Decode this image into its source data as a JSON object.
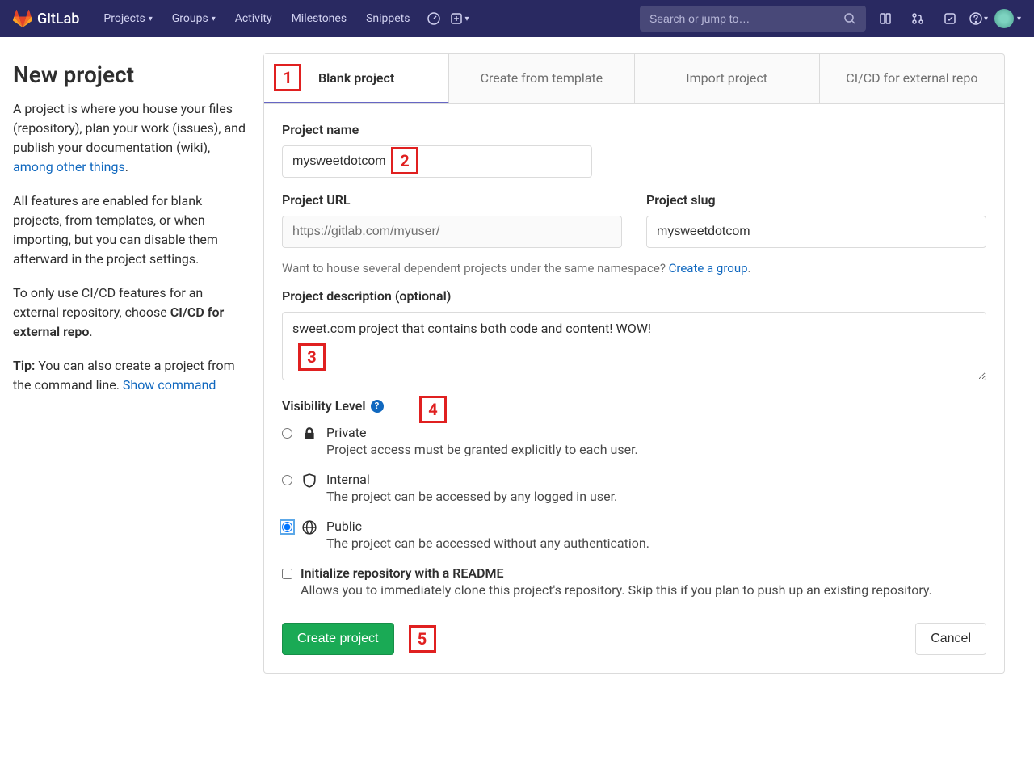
{
  "header": {
    "brand": "GitLab",
    "nav": {
      "projects": "Projects",
      "groups": "Groups",
      "activity": "Activity",
      "milestones": "Milestones",
      "snippets": "Snippets"
    },
    "search_placeholder": "Search or jump to…"
  },
  "sidebar": {
    "title": "New project",
    "p1_a": "A project is where you house your files (repository), plan your work (issues), and publish your documentation (wiki), ",
    "p1_link": "among other things",
    "p1_b": ".",
    "p2": "All features are enabled for blank projects, from templates, or when importing, but you can disable them afterward in the project settings.",
    "p3_a": "To only use CI/CD features for an external repository, choose ",
    "p3_b": "CI/CD for external repo",
    "p3_c": ".",
    "p4_a": "Tip:",
    "p4_b": " You can also create a project from the command line. ",
    "p4_link": "Show command"
  },
  "tabs": {
    "blank": "Blank project",
    "template": "Create from template",
    "import": "Import project",
    "cicd": "CI/CD for external repo"
  },
  "form": {
    "name_label": "Project name",
    "name_value": "mysweetdotcom",
    "url_label": "Project URL",
    "url_value": "https://gitlab.com/myuser/",
    "slug_label": "Project slug",
    "slug_value": "mysweetdotcom",
    "hint_a": "Want to house several dependent projects under the same namespace? ",
    "hint_link": "Create a group",
    "hint_b": ".",
    "desc_label": "Project description (optional)",
    "desc_value": "sweet.com project that contains both code and content! WOW!",
    "vis_label": "Visibility Level",
    "vis": {
      "private": {
        "title": "Private",
        "desc": "Project access must be granted explicitly to each user."
      },
      "internal": {
        "title": "Internal",
        "desc": "The project can be accessed by any logged in user."
      },
      "public": {
        "title": "Public",
        "desc": "The project can be accessed without any authentication."
      }
    },
    "readme": {
      "title": "Initialize repository with a README",
      "desc": "Allows you to immediately clone this project's repository. Skip this if you plan to push up an existing repository."
    },
    "create": "Create project",
    "cancel": "Cancel"
  },
  "markers": {
    "m1": "1",
    "m2": "2",
    "m3": "3",
    "m4": "4",
    "m5": "5"
  }
}
